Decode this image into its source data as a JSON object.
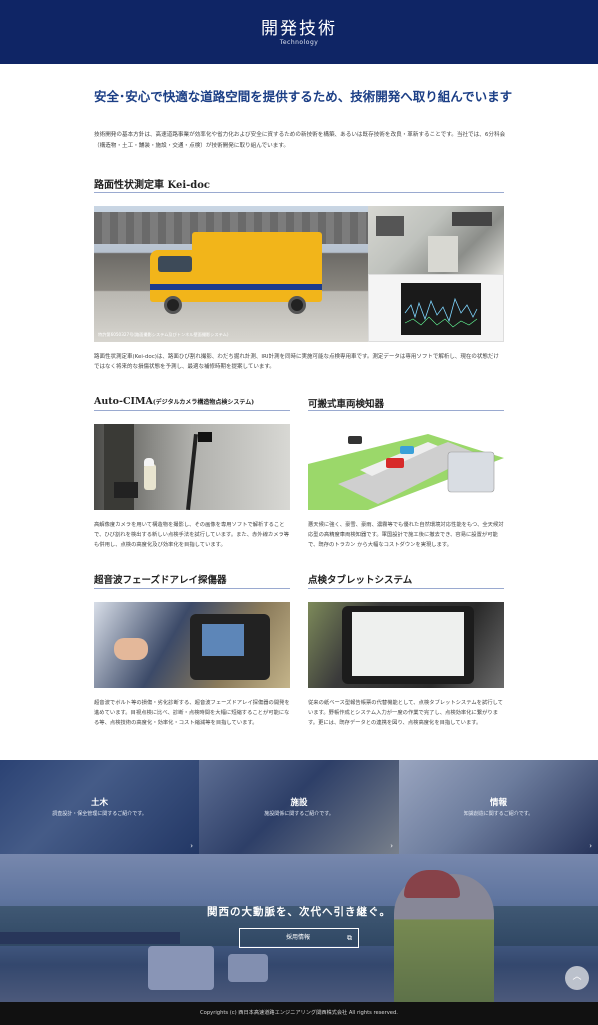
{
  "header": {
    "title": "開発技術",
    "subtitle": "Technology"
  },
  "intro": {
    "lead": "安全･安心で快適な道路空間を提供するため、技術開発へ取り組んでいます",
    "body": "技術開発の基本方針は、高速道路事業が効率化や省力化および安全に資するための新技術を構築、あるいは既存技術を改良・革新することです。当社では、6分科会（構造物・土工・舗装・施設・交通・点検）が技術開発に取り組んでいます。"
  },
  "keidoc": {
    "title": "路面性状測定車 Kei-doc",
    "caption": "特許第6050327号(路面撮影システム及びトンネル壁面撮影システム)",
    "desc": "路面性状測定車(Kei-doc)は、路面ひび割れ撮影、わだち掘れ計測、IRI計測を同時に実施可能な点検専用車です。測定データは専用ソフトで解析し、現在の状態だけではなく将来的な損傷状態を予測し、最適な補修時期を提案しています。"
  },
  "auto_cima": {
    "title": "Auto-CIMA",
    "title_note": "(デジタルカメラ構造物点検システム)",
    "desc": "高解像度カメラを用いて構造物を撮影し、その画像を専用ソフトで解析することで、ひび割れを検出する新しい点検手法を試行しています。また、赤外線カメラ等も併用し、点検の高度化及び効率化を目指しています。"
  },
  "kanou": {
    "title": "可搬式車両検知器",
    "desc": "悪天候に強く、豪雪、豪雨、濃霧等でも優れた自然環境対応性能をもつ、全天候対応型の高精度車両検知器です。軍国設計で施工後に撤去でき、容易に設置が可能で、既存のトラカン から大幅なコストダウンを実現します。"
  },
  "ultrasonic": {
    "title": "超音波フェーズドアレイ探傷器",
    "desc": "超音波でボルト等の損傷・劣化診断する、超音波フェーズドアレイ探傷器の開発を進めています。目視点検に比べ、診断・点検時間を大幅に短縮することが可能になる等、点検技術の高度化・効率化・コスト縮減等を目指しています。"
  },
  "tablet": {
    "title": "点検タブレットシステム",
    "desc": "従来の紙ベース型報告帳票の代替機能として、点検タブレットシステムを試行しています。野帳作成とシステム入力が一度の作業で完了し、点検効率化に繋がります。更には、既存データとの連携を図り、点検高度化を目指しています。"
  },
  "tiles": [
    {
      "title": "土木",
      "sub": "調査設計・保全管理に関するご紹介です。"
    },
    {
      "title": "施設",
      "sub": "施設関係に関するご紹介です。"
    },
    {
      "title": "情報",
      "sub": "知識創造に関するご紹介です。"
    }
  ],
  "hero": {
    "copy": "関西の大動脈を、次代へ引き継ぐ。",
    "button": "採用情報"
  },
  "footer": {
    "copyright": "Copyrights (c) 西日本高速道路エンジニアリング関西株式会社 All rights reserved."
  },
  "colors": {
    "header_bg": "#0f2565",
    "lead": "#1c3f86",
    "footer_bg": "#111111"
  }
}
